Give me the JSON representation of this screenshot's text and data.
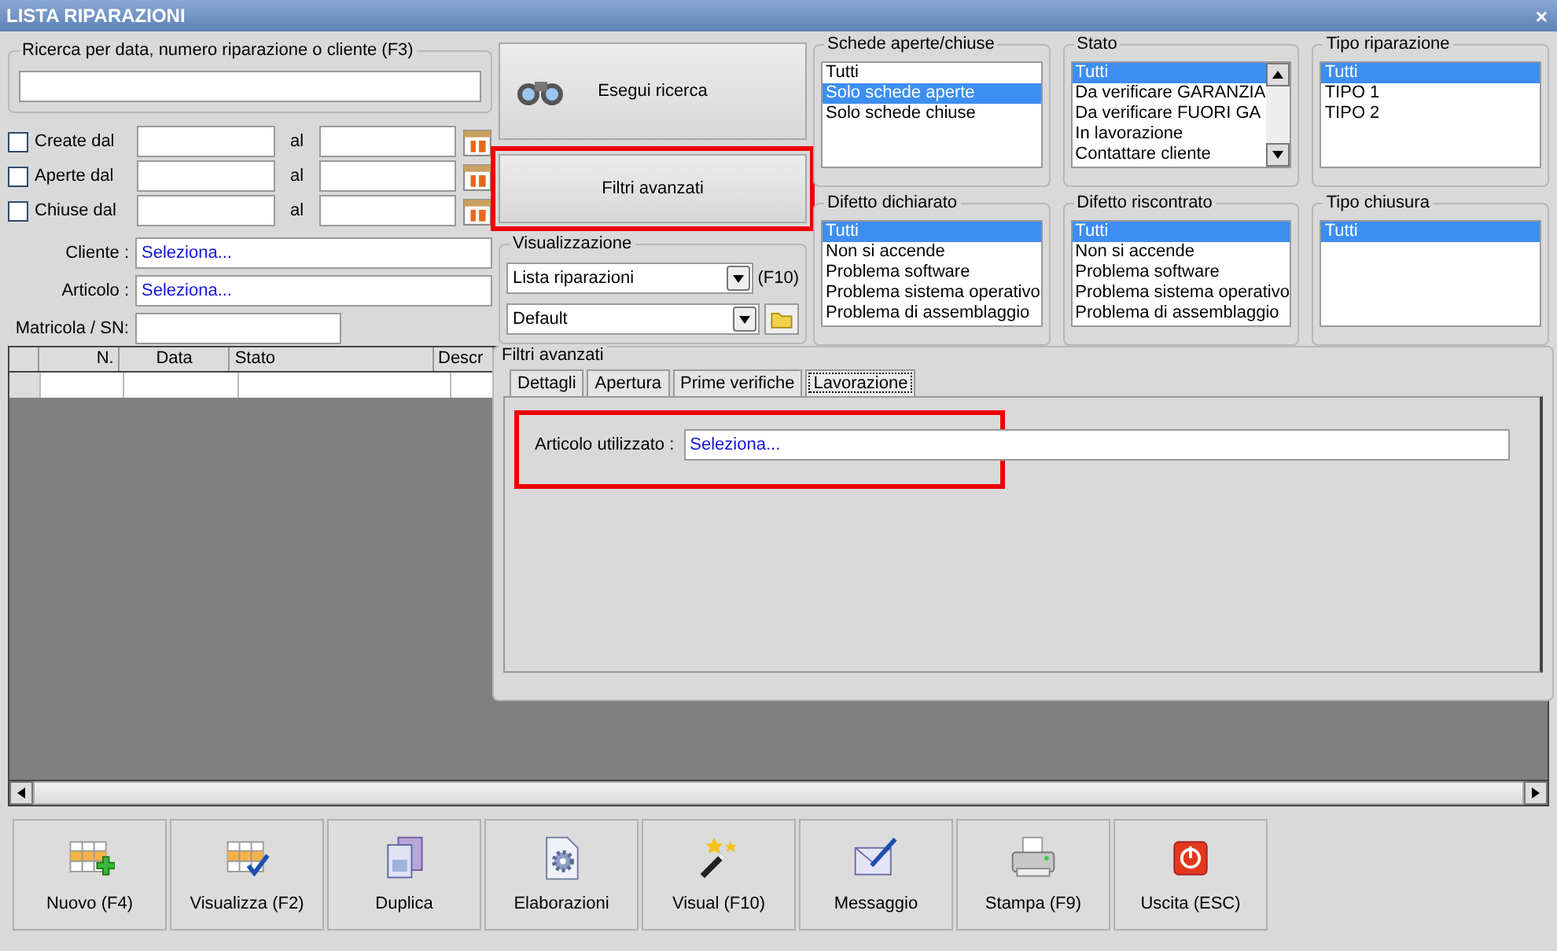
{
  "window": {
    "title": "LISTA RIPARAZIONI",
    "close": "×"
  },
  "search": {
    "label": "Ricerca per data, numero riparazione o cliente (F3)"
  },
  "date_filters": [
    {
      "label": "Create dal",
      "checked": false,
      "to_label": "al"
    },
    {
      "label": "Aperte dal",
      "checked": false,
      "to_label": "al"
    },
    {
      "label": "Chiuse dal",
      "checked": false,
      "to_label": "al"
    }
  ],
  "cliente": {
    "label": "Cliente :",
    "value": "Seleziona..."
  },
  "articolo": {
    "label": "Articolo :",
    "value": "Seleziona..."
  },
  "matricola": {
    "label": "Matricola / SN:"
  },
  "search_button": {
    "label": "Esegui ricerca"
  },
  "advanced_button": {
    "label": "Filtri avanzati",
    "highlighted": true
  },
  "visualizzazione": {
    "title": "Visualizzazione",
    "view": "Lista riparazioni",
    "shortcut": "(F10)",
    "layout": "Default"
  },
  "lists": [
    {
      "title": "Schede aperte/chiuse",
      "scrollbar": false,
      "items": [
        {
          "label": "Tutti",
          "selected": false
        },
        {
          "label": "Solo schede aperte",
          "selected": true
        },
        {
          "label": "Solo schede chiuse",
          "selected": false
        }
      ]
    },
    {
      "title": "Stato",
      "scrollbar": true,
      "items": [
        {
          "label": "Tutti",
          "selected": true
        },
        {
          "label": "Da verificare GARANZIA",
          "selected": false
        },
        {
          "label": "Da verificare FUORI GA",
          "selected": false
        },
        {
          "label": "In lavorazione",
          "selected": false
        },
        {
          "label": "Contattare cliente",
          "selected": false
        }
      ]
    },
    {
      "title": "Tipo riparazione",
      "scrollbar": false,
      "items": [
        {
          "label": "Tutti",
          "selected": true
        },
        {
          "label": "TIPO 1",
          "selected": false
        },
        {
          "label": "TIPO 2",
          "selected": false
        }
      ]
    },
    {
      "title": "Difetto dichiarato",
      "scrollbar": false,
      "items": [
        {
          "label": "Tutti",
          "selected": true
        },
        {
          "label": "Non si accende",
          "selected": false
        },
        {
          "label": "Problema software",
          "selected": false
        },
        {
          "label": "Problema sistema operativo",
          "selected": false
        },
        {
          "label": "Problema di assemblaggio",
          "selected": false
        }
      ]
    },
    {
      "title": "Difetto riscontrato",
      "scrollbar": false,
      "items": [
        {
          "label": "Tutti",
          "selected": true
        },
        {
          "label": "Non si accende",
          "selected": false
        },
        {
          "label": "Problema software",
          "selected": false
        },
        {
          "label": "Problema sistema operativo",
          "selected": false
        },
        {
          "label": "Problema di assemblaggio",
          "selected": false
        }
      ]
    },
    {
      "title": "Tipo chiusura",
      "scrollbar": false,
      "items": [
        {
          "label": "Tutti",
          "selected": true
        }
      ]
    }
  ],
  "table": {
    "columns": [
      "N.",
      "Data",
      "Stato",
      "Descr"
    ]
  },
  "advanced_filters": {
    "title": "Filtri avanzati",
    "tabs": [
      {
        "label": "Dettagli",
        "selected": false
      },
      {
        "label": "Apertura",
        "selected": false
      },
      {
        "label": "Prime verifiche",
        "selected": false
      },
      {
        "label": "Lavorazione",
        "selected": true
      }
    ],
    "field": {
      "label": "Articolo utilizzato :",
      "value": "Seleziona...",
      "highlighted": true
    }
  },
  "toolbar": [
    {
      "label": "Nuovo (F4)",
      "kind": "grid-add"
    },
    {
      "label": "Visualizza (F2)",
      "kind": "grid-check"
    },
    {
      "label": "Duplica",
      "kind": "copy"
    },
    {
      "label": "Elaborazioni",
      "kind": "gear-doc"
    },
    {
      "label": "Visual (F10)",
      "kind": "wand"
    },
    {
      "label": "Messaggio",
      "kind": "envelope"
    },
    {
      "label": "Stampa (F9)",
      "kind": "printer"
    },
    {
      "label": "Uscita (ESC)",
      "kind": "power"
    }
  ]
}
